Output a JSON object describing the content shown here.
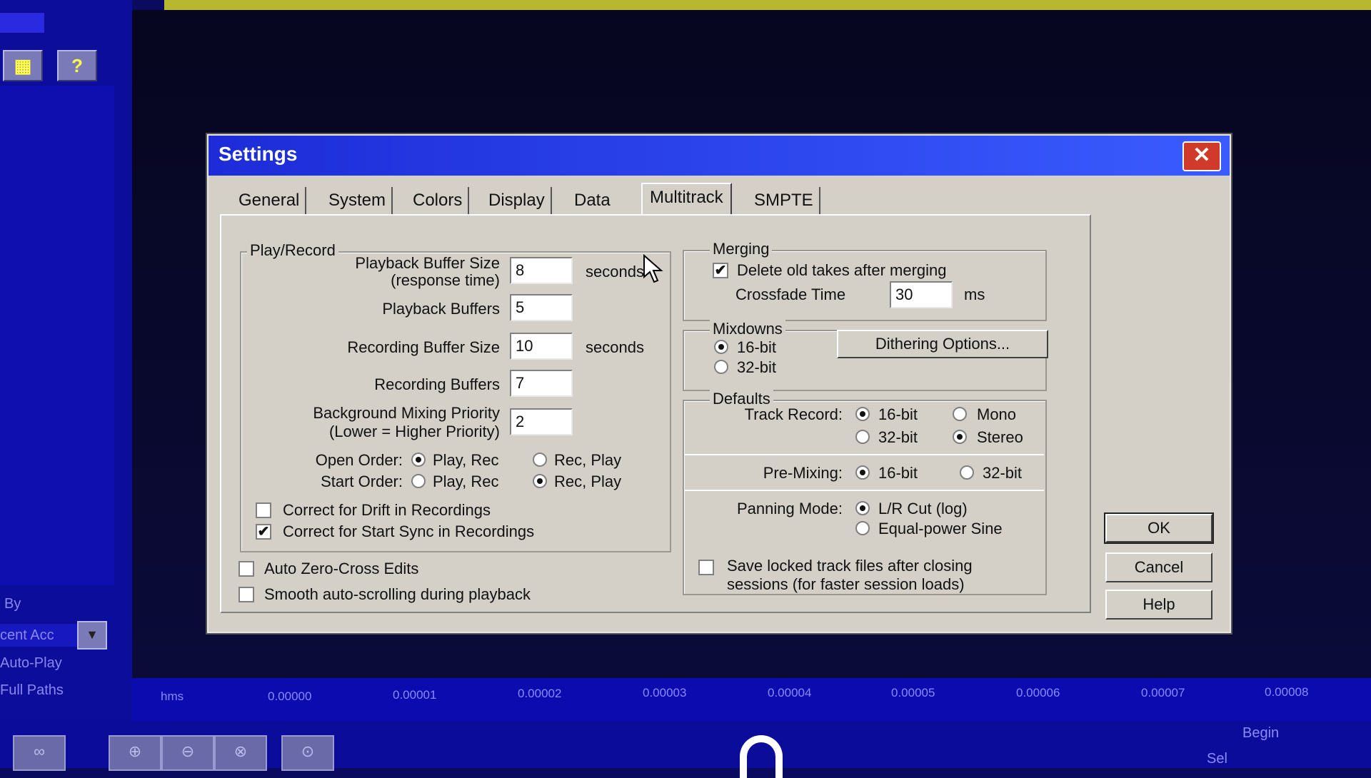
{
  "background": {
    "ruler_unit": "hms",
    "ruler_ticks": [
      "0.00000",
      "0.00001",
      "0.00002",
      "0.00003",
      "0.00004",
      "0.00005",
      "0.00006",
      "0.00007",
      "0.00008"
    ],
    "left_panel": {
      "sort_label": "By",
      "sort_value": "cent Acc",
      "auto_play": "Auto-Play",
      "full_paths": "Full Paths"
    },
    "begin_label": "Begin",
    "sel_label": "Sel",
    "help_icon_glyph": "?"
  },
  "dialog": {
    "title": "Settings",
    "close_glyph": "✕",
    "tabs": [
      {
        "label": "General"
      },
      {
        "label": "System"
      },
      {
        "label": "Colors"
      },
      {
        "label": "Display"
      },
      {
        "label": "Data"
      },
      {
        "label": "Multitrack",
        "active": true
      },
      {
        "label": "SMPTE"
      }
    ],
    "play_record": {
      "title": "Play/Record",
      "playback_buffer_size_label": "Playback Buffer Size",
      "playback_buffer_size_sub": "(response time)",
      "playback_buffer_size_value": "8",
      "playback_buffer_size_unit": "seconds",
      "playback_buffers_label": "Playback Buffers",
      "playback_buffers_value": "5",
      "recording_buffer_size_label": "Recording Buffer Size",
      "recording_buffer_size_value": "10",
      "recording_buffer_size_unit": "seconds",
      "recording_buffers_label": "Recording Buffers",
      "recording_buffers_value": "7",
      "bg_priority_label": "Background Mixing Priority",
      "bg_priority_sub": "(Lower = Higher Priority)",
      "bg_priority_value": "2",
      "open_order_label": "Open Order:",
      "start_order_label": "Start Order:",
      "opt_play_rec": "Play, Rec",
      "opt_rec_play": "Rec, Play",
      "open_order_selected": "Play, Rec",
      "start_order_selected": "Rec, Play",
      "drift_label": "Correct for Drift in Recordings",
      "drift_checked": false,
      "start_sync_label": "Correct for Start Sync in Recordings",
      "start_sync_checked": true
    },
    "auto_zero_cross_label": "Auto Zero-Cross Edits",
    "auto_zero_cross_checked": false,
    "smooth_scroll_label": "Smooth auto-scrolling during playback",
    "smooth_scroll_checked": false,
    "merging": {
      "title": "Merging",
      "delete_old_label": "Delete old takes after merging",
      "delete_old_checked": true,
      "crossfade_label": "Crossfade Time",
      "crossfade_value": "30",
      "crossfade_unit": "ms"
    },
    "mixdowns": {
      "title": "Mixdowns",
      "opt_16": "16-bit",
      "opt_32": "32-bit",
      "selected": "16-bit",
      "dither_button": "Dithering Options..."
    },
    "defaults": {
      "title": "Defaults",
      "track_record_label": "Track Record:",
      "opt_16": "16-bit",
      "opt_32": "32-bit",
      "opt_mono": "Mono",
      "opt_stereo": "Stereo",
      "bit_selected": "16-bit",
      "channel_selected": "Stereo",
      "premix_label": "Pre-Mixing:",
      "premix_selected": "16-bit",
      "panning_label": "Panning Mode:",
      "opt_lr_cut": "L/R Cut (log)",
      "opt_equal_power": "Equal-power Sine",
      "panning_selected": "L/R Cut (log)"
    },
    "save_locked_label": "Save locked track files after closing",
    "save_locked_sub": "sessions (for faster session loads)",
    "save_locked_checked": false,
    "ok_label": "OK",
    "cancel_label": "Cancel",
    "help_label": "Help"
  }
}
